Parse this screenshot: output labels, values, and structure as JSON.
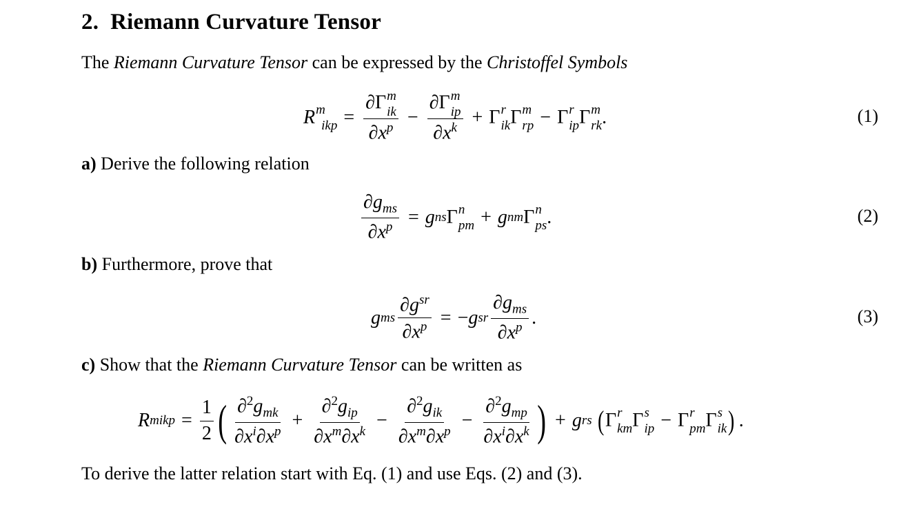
{
  "section": {
    "number": "2.",
    "title": "Riemann Curvature Tensor"
  },
  "intro": {
    "prefix": "The ",
    "term1": "Riemann Curvature Tensor",
    "middle": " can be expressed by the ",
    "term2": "Christoffel Symbols"
  },
  "equations": [
    {
      "number": "(1)",
      "latex": "R^{m}{}_{ikp} = \\frac{\\partial \\Gamma^m_{ik}}{\\partial x^p} - \\frac{\\partial \\Gamma^m_{ip}}{\\partial x^k} + \\Gamma^r_{ik}\\Gamma^m_{rp} - \\Gamma^r_{ip}\\Gamma^m_{rk}."
    },
    {
      "number": "(2)",
      "latex": "\\frac{\\partial g_{ms}}{\\partial x^p} = g_{ns}\\Gamma^n_{pm} + g_{nm}\\Gamma^n_{ps}."
    },
    {
      "number": "(3)",
      "latex": "g_{ms}\\frac{\\partial g^{sr}}{\\partial x^p} = -g^{sr}\\frac{\\partial g_{ms}}{\\partial x^p}."
    },
    {
      "number": "",
      "latex": "R_{mikp} = \\frac{1}{2}\\left(\\frac{\\partial^2 g_{mk}}{\\partial x^i \\partial x^p} + \\frac{\\partial^2 g_{ip}}{\\partial x^m \\partial x^k} - \\frac{\\partial^2 g_{ik}}{\\partial x^m \\partial x^p} - \\frac{\\partial^2 g_{mp}}{\\partial x^i \\partial x^k}\\right) + g_{rs}\\left(\\Gamma^r_{km}\\Gamma^s_{ip} - \\Gamma^r_{pm}\\Gamma^s_{ik}\\right)."
    }
  ],
  "parts": {
    "a": {
      "label": "a)",
      "text": " Derive the following relation"
    },
    "b": {
      "label": "b)",
      "text": " Furthermore, prove that"
    },
    "c": {
      "label": "c)",
      "prefix": " Show that the ",
      "term": "Riemann Curvature Tensor",
      "suffix": " can be written as"
    }
  },
  "closing": "To derive the latter relation start with Eq. (1) and use Eqs. (2) and (3)."
}
